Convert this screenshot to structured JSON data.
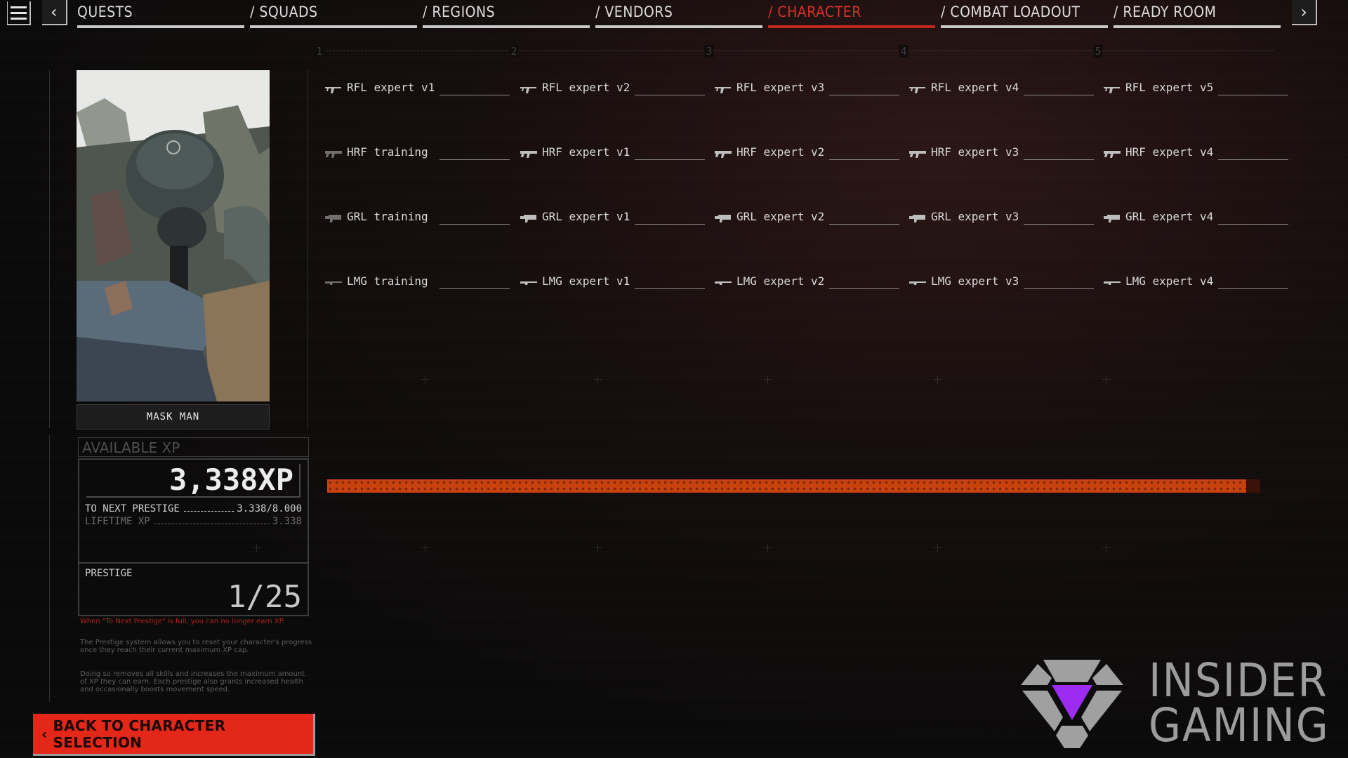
{
  "nav": {
    "menu_icon": "hamburger-menu-icon",
    "prev_icon": "chevron-left-icon",
    "next_icon": "chevron-right-icon",
    "prev_glyph": "‹",
    "next_glyph": "›",
    "tabs": [
      {
        "label": "QUESTS",
        "active": false
      },
      {
        "label": "/ SQUADS",
        "active": false
      },
      {
        "label": "/ REGIONS",
        "active": false
      },
      {
        "label": "/ VENDORS",
        "active": false
      },
      {
        "label": "/ CHARACTER",
        "active": true
      },
      {
        "label": "/ COMBAT LOADOUT",
        "active": false
      },
      {
        "label": "/ READY ROOM",
        "active": false
      }
    ]
  },
  "tier_ruler": [
    "1",
    "2",
    "3",
    "4",
    "5"
  ],
  "character": {
    "name": "MASK MAN",
    "portrait": "mask-man-portrait"
  },
  "xp": {
    "header": "AVAILABLE XP",
    "available": "3,338XP",
    "to_next_label": "TO NEXT PRESTIGE",
    "to_next_value": "3.338/8.000",
    "lifetime_label": "LIFETIME XP",
    "lifetime_value": "3.338",
    "progress_fraction": 0.985
  },
  "prestige": {
    "label": "PRESTIGE",
    "value": "1/25"
  },
  "notes": {
    "warning": "When \"To Next Prestige\" is full, you can no longer earn XP.",
    "info1": "The Prestige system allows you to reset your character's progress once they reach their current maximum XP cap.",
    "info2": "Doing so removes all skills and increases the maximum amount of XP they can earn. Each prestige also grants increased health and occasionally boosts movement speed."
  },
  "skills": [
    [
      {
        "name": "RFL expert v1",
        "icon": "rifle-icon"
      },
      {
        "name": "RFL expert v2",
        "icon": "rifle-icon"
      },
      {
        "name": "RFL expert v3",
        "icon": "rifle-icon"
      },
      {
        "name": "RFL expert v4",
        "icon": "rifle-icon"
      },
      {
        "name": "RFL expert v5",
        "icon": "rifle-icon"
      }
    ],
    [
      {
        "name": "HRF training",
        "icon": "heavy-rifle-icon"
      },
      {
        "name": "HRF expert v1",
        "icon": "heavy-rifle-icon"
      },
      {
        "name": "HRF expert v2",
        "icon": "heavy-rifle-icon"
      },
      {
        "name": "HRF expert v3",
        "icon": "heavy-rifle-icon"
      },
      {
        "name": "HRF expert v4",
        "icon": "heavy-rifle-icon"
      }
    ],
    [
      {
        "name": "GRL training",
        "icon": "grenade-launcher-icon"
      },
      {
        "name": "GRL expert v1",
        "icon": "grenade-launcher-icon"
      },
      {
        "name": "GRL expert v2",
        "icon": "grenade-launcher-icon"
      },
      {
        "name": "GRL expert v3",
        "icon": "grenade-launcher-icon"
      },
      {
        "name": "GRL expert v4",
        "icon": "grenade-launcher-icon"
      }
    ],
    [
      {
        "name": "LMG training",
        "icon": "light-machine-gun-icon"
      },
      {
        "name": "LMG expert v1",
        "icon": "light-machine-gun-icon"
      },
      {
        "name": "LMG expert v2",
        "icon": "light-machine-gun-icon"
      },
      {
        "name": "LMG expert v3",
        "icon": "light-machine-gun-icon"
      },
      {
        "name": "LMG expert v4",
        "icon": "light-machine-gun-icon"
      }
    ]
  ],
  "back_button": {
    "label": "BACK TO CHARACTER SELECTION",
    "glyph": "‹"
  },
  "watermark": {
    "line1": "INSIDER",
    "line2": "GAMING",
    "accent": "#9b2cf0"
  },
  "colors": {
    "accent_red": "#e3281a",
    "active_tab": "#d6302a",
    "progress": "#c8420f"
  }
}
